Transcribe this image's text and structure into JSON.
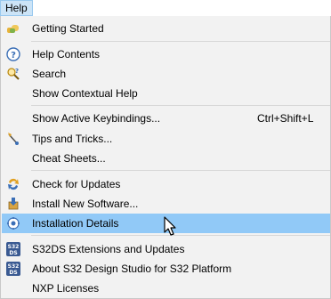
{
  "menubar": {
    "title": "Help"
  },
  "menu": {
    "items": [
      {
        "label": "Getting Started",
        "icon": "getting-started-icon"
      },
      {
        "label": "Help Contents",
        "icon": "help-contents-icon"
      },
      {
        "label": "Search",
        "icon": "search-icon"
      },
      {
        "label": "Show Contextual Help",
        "icon": ""
      },
      {
        "label": "Show Active Keybindings...",
        "shortcut": "Ctrl+Shift+L"
      },
      {
        "label": "Tips and Tricks...",
        "icon": "tips-icon"
      },
      {
        "label": "Cheat Sheets..."
      },
      {
        "label": "Check for Updates",
        "icon": "update-icon"
      },
      {
        "label": "Install New Software...",
        "icon": "install-icon"
      },
      {
        "label": "Installation Details",
        "icon": "installation-details-icon"
      },
      {
        "label": "S32DS Extensions and Updates",
        "icon": "s32ds-icon"
      },
      {
        "label": "About S32 Design Studio for S32 Platform",
        "icon": "s32ds-icon"
      },
      {
        "label": "NXP Licenses"
      }
    ]
  },
  "colors": {
    "highlight": "#91c9f7",
    "menu_background": "#f2f2f2",
    "menubar_active": "#cce4f7"
  }
}
